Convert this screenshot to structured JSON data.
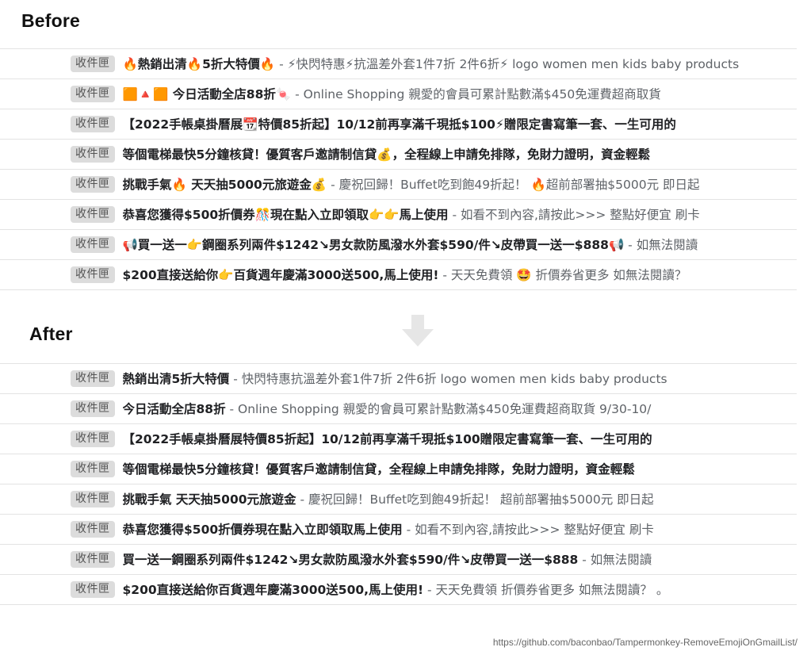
{
  "before": {
    "title": "Before",
    "rows": [
      {
        "label": "收件匣",
        "subject": "🔥熱銷出清🔥5折大特價🔥",
        "snippet": " - ⚡快閃特惠⚡抗溫差外套1件7折 2件6折⚡ logo women men kids baby products"
      },
      {
        "label": "收件匣",
        "subject": "🟧🔺🟧 今日活動全店88折🍬",
        "snippet": " - Online Shopping 親愛的會員可累計點數滿$450免運費超商取貨"
      },
      {
        "label": "收件匣",
        "subject": "【2022手帳桌掛曆展📆特價85折起】10/12前再享滿千現抵$100⚡贈限定書寫筆一套、一生可用的",
        "snippet": ""
      },
      {
        "label": "收件匣",
        "subject": "等個電梯最快5分鐘核貸！優質客戶邀請制信貸💰，全程線上申請免排隊，免財力證明，資金輕鬆",
        "snippet": ""
      },
      {
        "label": "收件匣",
        "subject": "挑戰手氣🔥 天天抽5000元旅遊金💰",
        "snippet": " - 慶祝回歸！Buffet吃到飽49折起！ 🔥超前部署抽$5000元 即日起"
      },
      {
        "label": "收件匣",
        "subject": "恭喜您獲得$500折價券🎊現在點入立即領取👉👉馬上使用",
        "snippet": " - 如看不到內容,請按此>>> 整點好便宜 刷卡"
      },
      {
        "label": "收件匣",
        "subject": "📢買一送一👉鋼圈系列兩件$1242↘男女款防風潑水外套$590/件↘皮帶買一送一$888📢",
        "snippet": " - 如無法閱讀"
      },
      {
        "label": "收件匣",
        "subject": "$200直接送給你👉百貨週年慶滿3000送500,馬上使用!",
        "snippet": " - 天天免費領 🤩 折價券省更多 如無法閱讀？"
      }
    ]
  },
  "after": {
    "title": "After",
    "rows": [
      {
        "label": "收件匣",
        "subject": "熱銷出清5折大特價",
        "snippet": " - 快閃特惠抗溫差外套1件7折 2件6折 logo women men kids baby products"
      },
      {
        "label": "收件匣",
        "subject": "今日活動全店88折",
        "snippet": " - Online Shopping 親愛的會員可累計點數滿$450免運費超商取貨 9/30-10/"
      },
      {
        "label": "收件匣",
        "subject": "【2022手帳桌掛曆展特價85折起】10/12前再享滿千現抵$100贈限定書寫筆一套、一生可用的",
        "snippet": ""
      },
      {
        "label": "收件匣",
        "subject": "等個電梯最快5分鐘核貸！優質客戶邀請制信貸，全程線上申請免排隊，免財力證明，資金輕鬆",
        "snippet": ""
      },
      {
        "label": "收件匣",
        "subject": "挑戰手氣 天天抽5000元旅遊金",
        "snippet": " - 慶祝回歸！Buffet吃到飽49折起！ 超前部署抽$5000元 即日起"
      },
      {
        "label": "收件匣",
        "subject": "恭喜您獲得$500折價券現在點入立即領取馬上使用",
        "snippet": " - 如看不到內容,請按此>>> 整點好便宜 刷卡"
      },
      {
        "label": "收件匣",
        "subject": "買一送一鋼圈系列兩件$1242↘男女款防風潑水外套$590/件↘皮帶買一送一$888",
        "snippet": " - 如無法閱讀"
      },
      {
        "label": "收件匣",
        "subject": "$200直接送給你百貨週年慶滿3000送500,馬上使用!",
        "snippet": " - 天天免費領 折價券省更多 如無法閱讀？ 。"
      }
    ]
  },
  "arrow_icon": "arrow-down-icon",
  "footer_url": "https://github.com/baconbao/Tampermonkey-RemoveEmojiOnGmailList/"
}
